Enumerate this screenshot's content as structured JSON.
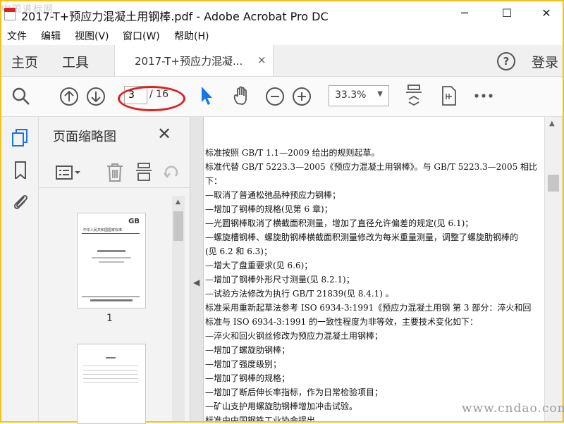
{
  "window": {
    "title": "2017-T+预应力混凝土用钢棒.pdf - Adobe Acrobat Pro DC",
    "watermark_top": "中国道标网",
    "minimize": "─",
    "maximize": "☐",
    "close": "✕"
  },
  "menu": [
    "文件",
    "编辑",
    "视图(V)",
    "窗口(W)",
    "帮助(H)"
  ],
  "tabs": {
    "home": "主页",
    "tools": "工具",
    "document": "2017-T+预应力混凝...",
    "close": "×",
    "help": "?",
    "login": "登录"
  },
  "toolbar": {
    "current_page": "3",
    "total_pages": "/ 16",
    "zoom": "33.3%"
  },
  "sidebar": {
    "panel_title": "页面缩略图",
    "thumbnail_label": "1",
    "thumb1_title": "中华人民共和国国家标准",
    "thumb1_gb": "GB"
  },
  "document_lines": [
    "标准按照 GB/T 1.1—2009 给出的规则起草。",
    "标准代替 GB/T 5223.3—2005《预应力混凝土用钢棒》。与 GB/T 5223.3—2005 相比",
    "下：",
    "—取消了普通松弛品种预应力钢棒；",
    "—增加了钢棒的规格(见第 6 章)；",
    "—光圆钢棒取消了横截面积测量，增加了直径允许偏差的规定(见 6.1)；",
    "—螺旋槽钢棒、螺旋肋钢棒横截面积测量修改为每米重量测量，调整了螺旋肋钢棒的",
    "  (见 6.2 和 6.3)；",
    "—增大了盘重要求(见 6.6)；",
    "—增加了钢棒外形尺寸测量(见 8.2.1)；",
    "—试验方法修改为执行 GB/T 21839(见 8.4.1) 。",
    "标准采用重新起草法参考 ISO 6934-3:1991《预应力混凝土用钢    第 3 部分：淬火和回",
    "标准与 ISO 6934-3:1991 的一致性程度为非等效，主要技术变化如下：",
    "—淬火和回火钢丝修改为预应力混凝土用钢棒；",
    "—增加了螺旋肋钢棒；",
    "—增加了强度级别；",
    "—增加了钢棒的规格；",
    "—增加了断后伸长率指标，作为日常检验项目；",
    "—矿山支护用螺旋肋钢棒增加冲击试验。",
    "标准由中国钢铁工业协会提出"
  ],
  "watermark_bottom": "www.cndao.com",
  "colors": {
    "frame": "#f0c419",
    "highlight_oval": "#e0201f",
    "select_tool": "#1a73e8"
  }
}
